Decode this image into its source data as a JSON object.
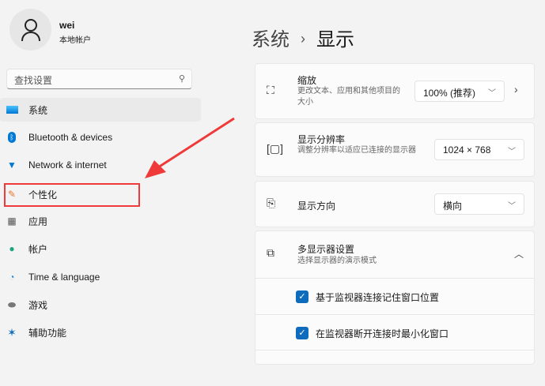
{
  "user": {
    "name": "wei",
    "type": "本地帐户"
  },
  "search": {
    "placeholder": "查找设置"
  },
  "nav": [
    {
      "label": "系统",
      "icon": "monitor-icon"
    },
    {
      "label": "Bluetooth & devices",
      "icon": "bluetooth-icon"
    },
    {
      "label": "Network & internet",
      "icon": "wifi-icon"
    },
    {
      "label": "个性化",
      "icon": "brush-icon"
    },
    {
      "label": "应用",
      "icon": "apps-icon"
    },
    {
      "label": "帐户",
      "icon": "person-icon"
    },
    {
      "label": "Time & language",
      "icon": "globe-clock-icon"
    },
    {
      "label": "游戏",
      "icon": "gamepad-icon"
    },
    {
      "label": "辅助功能",
      "icon": "accessibility-icon"
    }
  ],
  "breadcrumb": {
    "parent": "系统",
    "sep": "›",
    "current": "显示"
  },
  "settings": {
    "scale": {
      "label": "缩放",
      "desc": "更改文本、应用和其他项目的大小",
      "value": "100% (推荐)"
    },
    "resolution": {
      "label": "显示分辨率",
      "desc": "调整分辨率以适应已连接的显示器",
      "value": "1024 × 768"
    },
    "orientation": {
      "label": "显示方向",
      "value": "横向"
    },
    "multi": {
      "label": "多显示器设置",
      "desc": "选择显示器的演示模式",
      "options": [
        {
          "label": "基于监视器连接记住窗口位置",
          "checked": true
        },
        {
          "label": "在监视器断开连接时最小化窗口",
          "checked": true
        }
      ]
    }
  },
  "colors": {
    "accent": "#0f6cbd",
    "annotation": "#f03a3a"
  }
}
